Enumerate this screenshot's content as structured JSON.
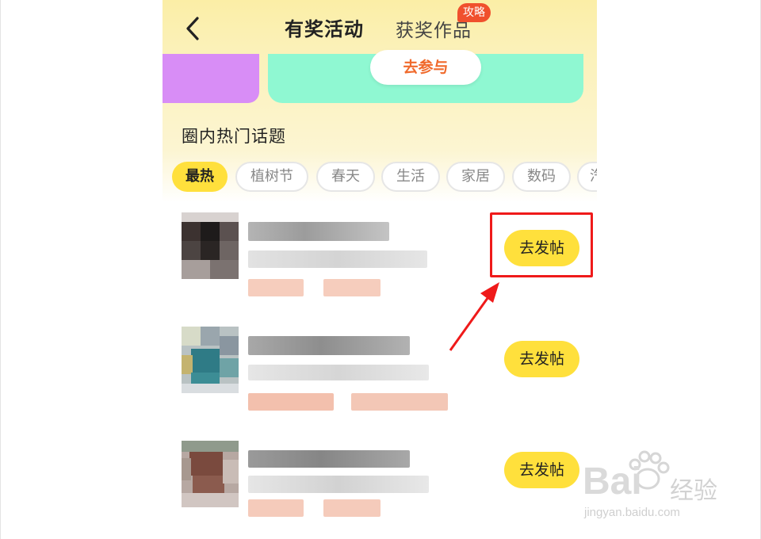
{
  "topbar": {
    "tab_active": "有奖活动",
    "tab_inactive": "获奖作品",
    "badge": "攻略"
  },
  "banner": {
    "join_label": "去参与"
  },
  "section": {
    "title": "圈内热门话题"
  },
  "chips": [
    "最热",
    "植树节",
    "春天",
    "生活",
    "家居",
    "数码",
    "汽"
  ],
  "topics": [
    {
      "action_label": "去发帖"
    },
    {
      "action_label": "去发帖"
    },
    {
      "action_label": "去发帖"
    }
  ],
  "watermark": {
    "brand": "Bai",
    "cn": "经验",
    "url": "jingyan.baidu.com"
  },
  "colors": {
    "accent_yellow": "#ffe03c",
    "highlight_red": "#ef1a1a",
    "join_orange": "#f06a2c",
    "banner_green": "#8ff8d2",
    "banner_purple": "#d88df6"
  }
}
